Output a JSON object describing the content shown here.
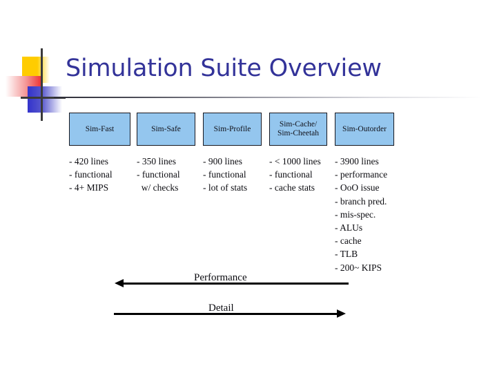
{
  "slide": {
    "title": "Simulation Suite Overview",
    "title_color": "#333399",
    "background_color": "#ffffff",
    "decoration": {
      "yellow_color": "#FFCC00",
      "red_color": "#EE3333",
      "blue_color": "#3333CC",
      "line_color": "#3A3A3A"
    }
  },
  "simulators": [
    {
      "name": "Sim-Fast",
      "name_line2": "",
      "box_color": "#94C6EE",
      "details": [
        "- 420 lines",
        "- functional",
        "- 4+ MIPS"
      ]
    },
    {
      "name": "Sim-Safe",
      "name_line2": "",
      "box_color": "#94C6EE",
      "details": [
        "- 350 lines",
        "- functional",
        "  w/ checks"
      ]
    },
    {
      "name": "Sim-Profile",
      "name_line2": "",
      "box_color": "#94C6EE",
      "details": [
        "- 900 lines",
        "- functional",
        "- lot of stats"
      ]
    },
    {
      "name": "Sim-Cache/",
      "name_line2": "Sim-Cheetah",
      "box_color": "#94C6EE",
      "details": [
        "- < 1000 lines",
        "- functional",
        "- cache stats"
      ]
    },
    {
      "name": "Sim-Outorder",
      "name_line2": "",
      "box_color": "#94C6EE",
      "details": [
        "- 3900 lines",
        "- performance",
        "- OoO issue",
        "- branch pred.",
        "- mis-spec.",
        "- ALUs",
        "- cache",
        "- TLB",
        "- 200~ KIPS"
      ]
    }
  ],
  "axes": [
    {
      "label": "Performance",
      "direction": "left"
    },
    {
      "label": "Detail",
      "direction": "right"
    }
  ]
}
